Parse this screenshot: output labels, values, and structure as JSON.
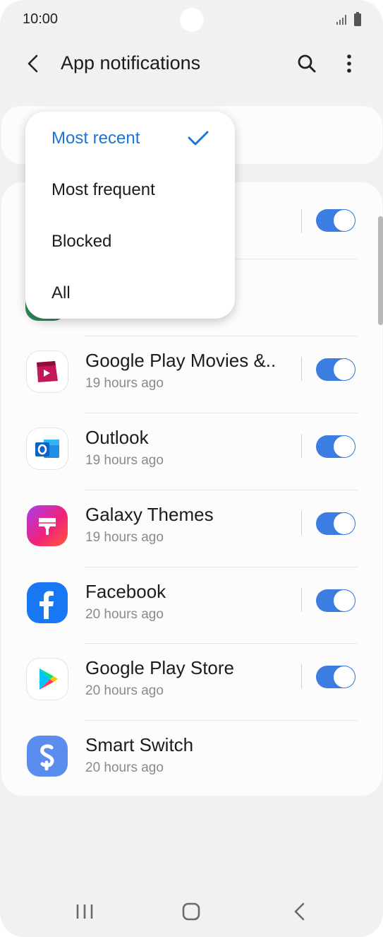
{
  "status_bar": {
    "time": "10:00",
    "icons": [
      "signal-icon",
      "battery-icon"
    ]
  },
  "app_bar": {
    "title": "App notifications",
    "icons": [
      "back-arrow-icon",
      "search-icon",
      "more-vertical-icon"
    ]
  },
  "sort_menu": {
    "selected": "Most recent",
    "options": [
      {
        "label": "Most recent",
        "selected": true
      },
      {
        "label": "Most frequent",
        "selected": false
      },
      {
        "label": "Blocked",
        "selected": false
      },
      {
        "label": "All",
        "selected": false
      }
    ]
  },
  "apps": [
    {
      "name": "Google Play Movies &..",
      "time": "19 hours ago",
      "enabled": true,
      "icon": "google-play-movies-icon"
    },
    {
      "name": "Outlook",
      "time": "19 hours ago",
      "enabled": true,
      "icon": "outlook-icon"
    },
    {
      "name": "Galaxy Themes",
      "time": "19 hours ago",
      "enabled": true,
      "icon": "galaxy-themes-icon"
    },
    {
      "name": "Facebook",
      "time": "20 hours ago",
      "enabled": true,
      "icon": "facebook-icon"
    },
    {
      "name": "Google Play Store",
      "time": "20 hours ago",
      "enabled": true,
      "icon": "google-play-store-icon"
    },
    {
      "name": "Smart Switch",
      "time": "20 hours ago",
      "icon": "smart-switch-icon"
    }
  ],
  "nav_bar": {
    "icons": [
      "recents-icon",
      "home-icon",
      "back-icon"
    ]
  },
  "colors": {
    "accent": "#3b7de0",
    "selected_text": "#1b74d6",
    "background": "#f1f1f1",
    "card": "#fcfcfc"
  }
}
